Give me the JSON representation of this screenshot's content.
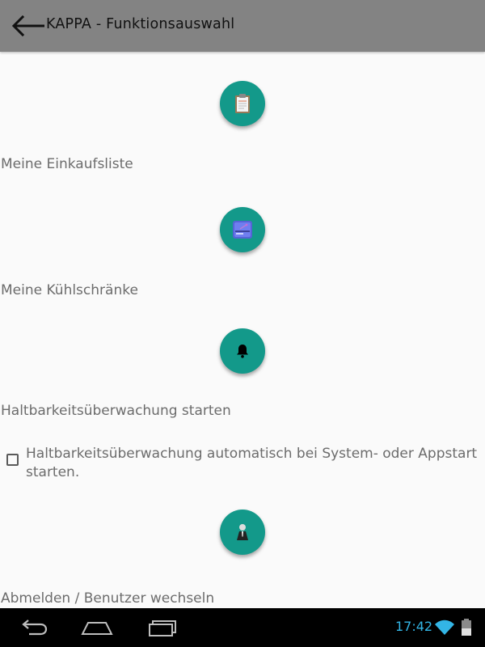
{
  "toolbar": {
    "title": "KAPPA - Funktionsauswahl",
    "back_icon": "arrow-left-icon"
  },
  "menu": {
    "items": [
      {
        "label": "Meine Einkaufsliste",
        "icon": "clipboard-icon"
      },
      {
        "label": "Meine Kühlschränke",
        "icon": "fridge-icon"
      },
      {
        "label": "Haltbarkeitsüberwachung starten",
        "icon": "bell-icon"
      },
      {
        "label": "Abmelden / Benutzer wechseln",
        "icon": "user-icon"
      }
    ],
    "autostart_checkbox": {
      "label": "Haltbarkeitsüberwachung automatisch bei System- oder Appstart starten.",
      "checked": false
    }
  },
  "system_bar": {
    "time": "17:42",
    "nav_icons": [
      "back-nav-icon",
      "home-nav-icon",
      "recents-nav-icon"
    ]
  },
  "colors": {
    "toolbar": "#838383",
    "fab": "#13998a",
    "label": "#6c6c6c",
    "status_time": "#33b5e5"
  }
}
